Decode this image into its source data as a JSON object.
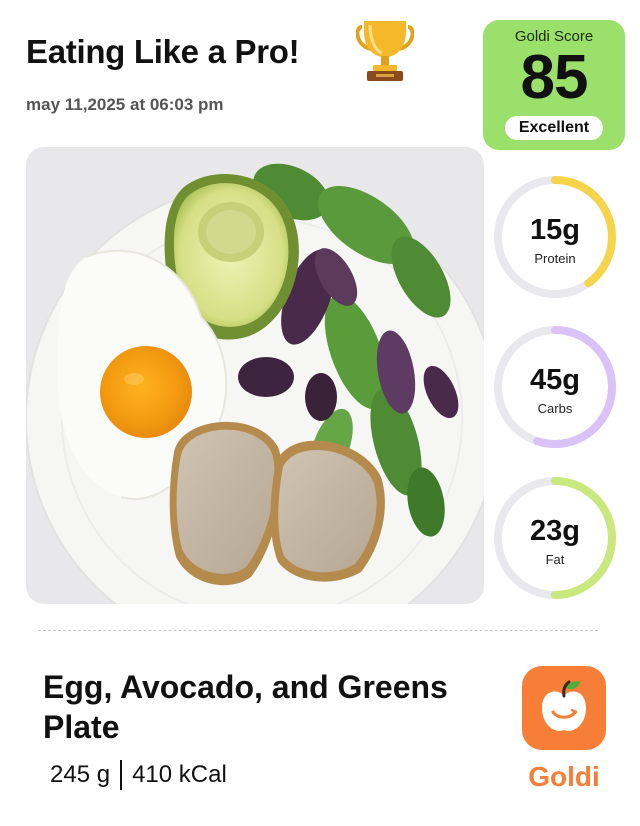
{
  "header": {
    "title": "Eating Like a Pro!",
    "datetime": "may 11,2025 at 06:03 pm",
    "trophy_icon": "trophy-icon"
  },
  "score": {
    "label": "Goldi Score",
    "value": "85",
    "badge": "Excellent",
    "color": "#9ae06a"
  },
  "photo": {
    "icon": "meal-photo-egg-avocado-greens"
  },
  "macros": [
    {
      "value": "15g",
      "label": "Protein",
      "fraction": 0.4,
      "color": "#f5d44a"
    },
    {
      "value": "45g",
      "label": "Carbs",
      "fraction": 0.55,
      "color": "#d8c2f7"
    },
    {
      "value": "23g",
      "label": "Fat",
      "fraction": 0.5,
      "color": "#c9e87e"
    }
  ],
  "food": {
    "name": "Egg, Avocado, and Greens Plate",
    "weight": "245 g",
    "calories": "410 kCal"
  },
  "app": {
    "name": "Goldi",
    "icon": "apple-smile-icon",
    "color": "#f77e37"
  }
}
